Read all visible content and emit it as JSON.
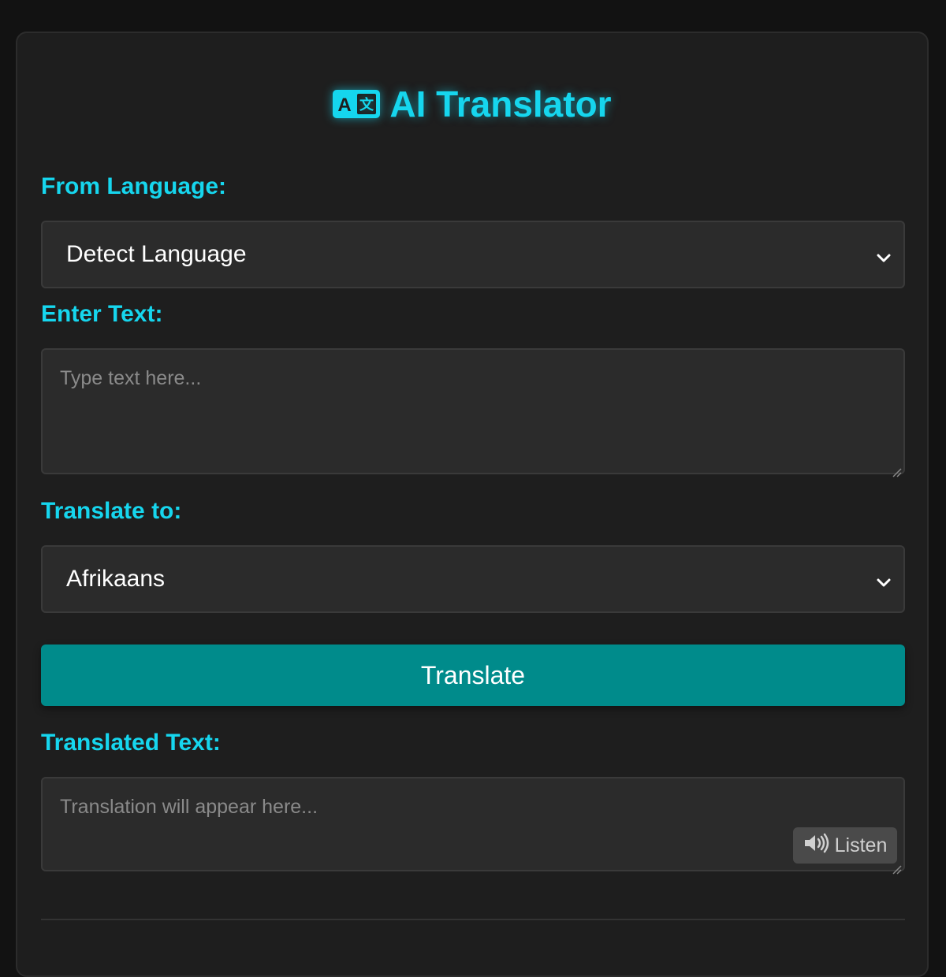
{
  "header": {
    "title": "AI Translator",
    "icon": "translate-icon"
  },
  "from_language": {
    "label": "From Language:",
    "selected": "Detect Language"
  },
  "input_text": {
    "label": "Enter Text:",
    "placeholder": "Type text here...",
    "value": ""
  },
  "to_language": {
    "label": "Translate to:",
    "selected": "Afrikaans"
  },
  "actions": {
    "translate_label": "Translate",
    "listen_label": "Listen"
  },
  "output_text": {
    "label": "Translated Text:",
    "placeholder": "Translation will appear here..."
  },
  "colors": {
    "accent": "#16d6ee",
    "button": "#008b8b",
    "background": "#121212",
    "card": "#1e1e1e",
    "field": "#2b2b2b"
  }
}
